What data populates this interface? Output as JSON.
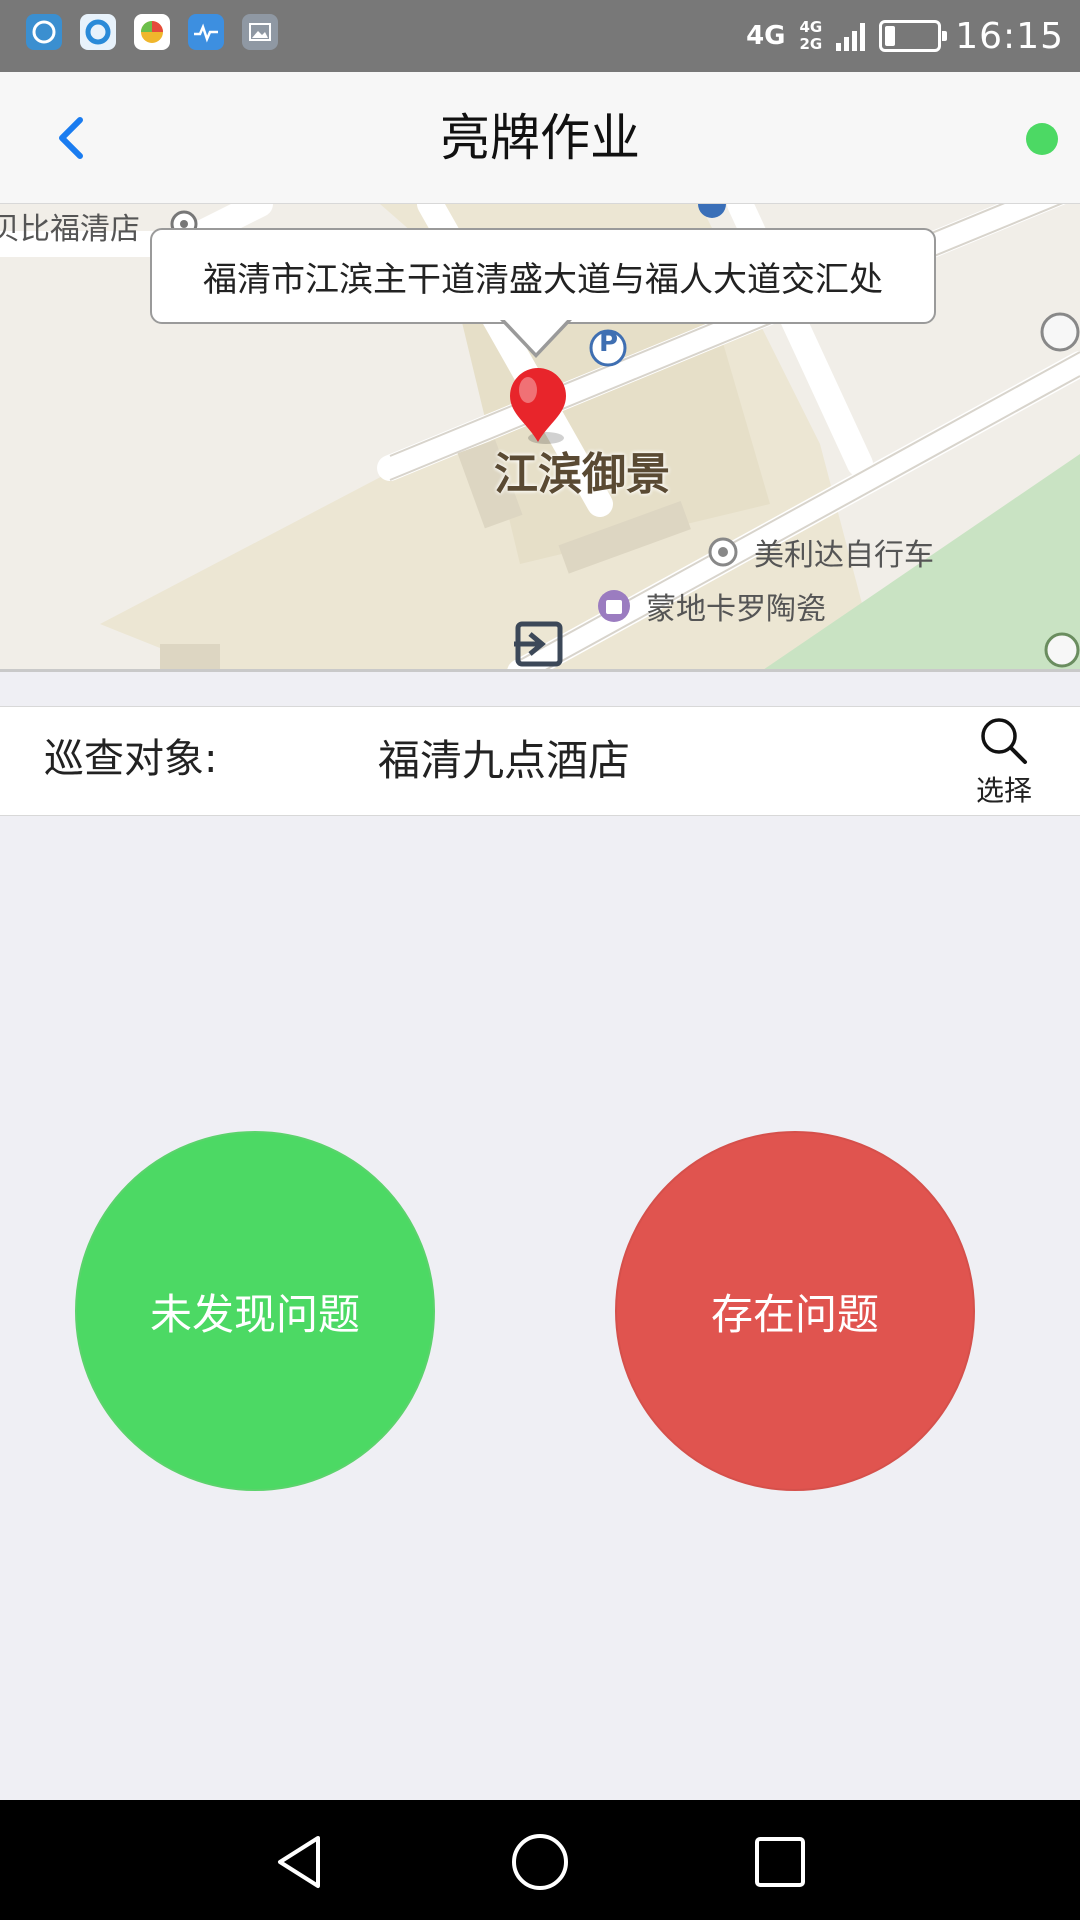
{
  "status_bar": {
    "network_type": "4G",
    "network_secondary_top": "4G",
    "network_secondary_bottom": "2G",
    "time": "16:15",
    "battery_level": 0.2,
    "app_icons": [
      "clock-icon",
      "browser-icon",
      "game-icon",
      "health-icon",
      "gallery-icon"
    ]
  },
  "header": {
    "title": "亮牌作业",
    "status_color": "#4cd964"
  },
  "map": {
    "address": "福清市江滨主干道清盛大道与福人大道交汇处",
    "pois": {
      "top_left": "贝比福清店",
      "main": "江滨御景",
      "bike_shop": "美利达自行车",
      "ceramics": "蒙地卡罗陶瓷",
      "parking": "P"
    }
  },
  "patrol": {
    "label": "巡查对象:",
    "value": "福清九点酒店",
    "select_label": "选择"
  },
  "actions": {
    "no_issue_label": "未发现问题",
    "has_issue_label": "存在问题",
    "no_issue_color": "#4cd964",
    "has_issue_color": "#e0544f"
  }
}
